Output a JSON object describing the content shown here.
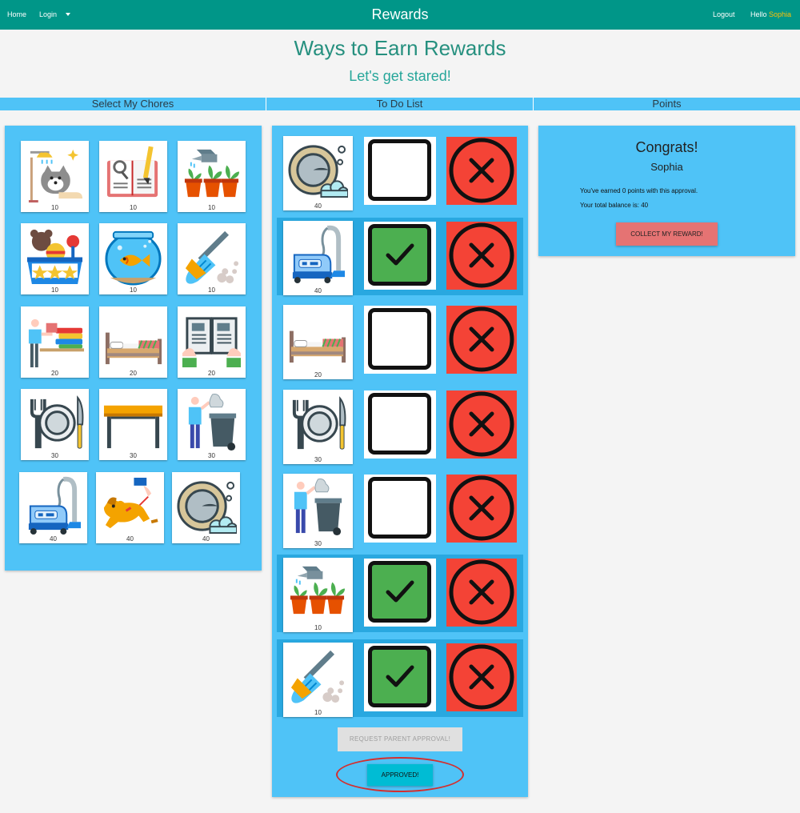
{
  "nav": {
    "home": "Home",
    "login": "Login",
    "title": "Rewards",
    "logout": "Logout",
    "hello": "Hello",
    "user": "Sophia"
  },
  "heading": "Ways to Earn Rewards",
  "subheading": "Let's get stared!",
  "columns": {
    "select": "Select My Chores",
    "todo": "To Do List",
    "points": "Points"
  },
  "chores": [
    {
      "icon": "dog-shower-icon",
      "points": "10"
    },
    {
      "icon": "homework-book-icon",
      "points": "10"
    },
    {
      "icon": "water-plants-icon",
      "points": "10"
    },
    {
      "icon": "toy-box-icon",
      "points": "10"
    },
    {
      "icon": "fish-bowl-icon",
      "points": "10"
    },
    {
      "icon": "broom-icon",
      "points": "10"
    },
    {
      "icon": "fold-laundry-icon",
      "points": "20"
    },
    {
      "icon": "make-bed-icon",
      "points": "20"
    },
    {
      "icon": "reading-icon",
      "points": "20"
    },
    {
      "icon": "set-table-icon",
      "points": "30"
    },
    {
      "icon": "clear-table-icon",
      "points": "30"
    },
    {
      "icon": "take-out-trash-icon",
      "points": "30"
    },
    {
      "icon": "vacuum-icon",
      "points": "40"
    },
    {
      "icon": "walk-dog-icon",
      "points": "40"
    },
    {
      "icon": "wash-dishes-icon",
      "points": "40"
    }
  ],
  "todo": [
    {
      "icon": "wash-dishes-icon",
      "points": "40",
      "checked": false
    },
    {
      "icon": "vacuum-icon",
      "points": "40",
      "checked": true
    },
    {
      "icon": "make-bed-icon",
      "points": "20",
      "checked": false
    },
    {
      "icon": "set-table-icon",
      "points": "30",
      "checked": false
    },
    {
      "icon": "take-out-trash-icon",
      "points": "30",
      "checked": false
    },
    {
      "icon": "water-plants-icon",
      "points": "10",
      "checked": true
    },
    {
      "icon": "broom-icon",
      "points": "10",
      "checked": true
    }
  ],
  "buttons": {
    "request": "REQUEST PARENT APPROVAL!",
    "approved": "APPROVED!",
    "collect": "COLLECT MY REWARD!"
  },
  "points": {
    "congrats": "Congrats!",
    "name": "Sophia",
    "earned": "You've earned 0 points with this approval.",
    "balance": "Your total balance is: 40"
  },
  "colors": {
    "nav": "#009688",
    "panel": "#4fc3f7",
    "check_on": "#4caf50",
    "remove": "#f44336",
    "approve": "#00bcd4",
    "collect": "#e57373"
  }
}
